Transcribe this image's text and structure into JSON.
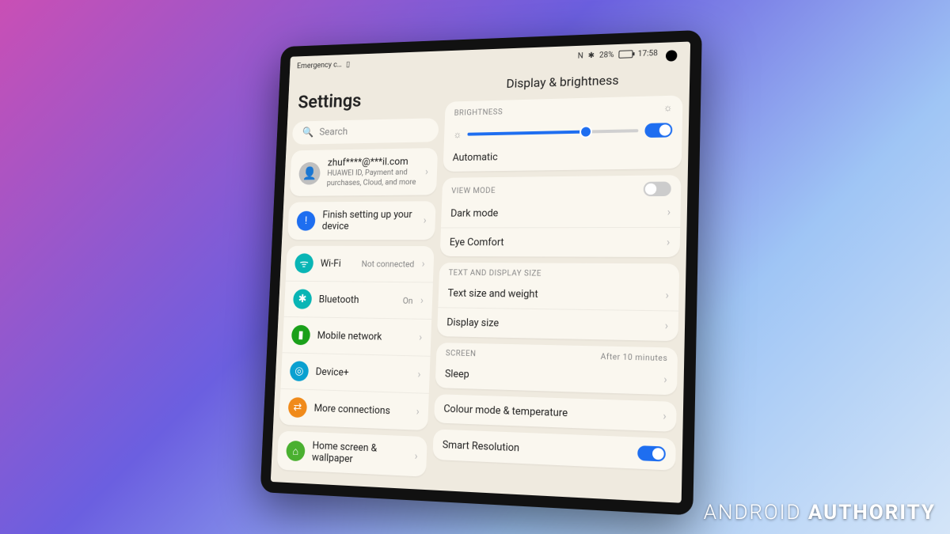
{
  "statusbar": {
    "emergency": "Emergency c…",
    "nfc": "N",
    "bluetooth": "✱",
    "battery_text": "28%",
    "time": "17:58"
  },
  "sidebar": {
    "title": "Settings",
    "search_placeholder": "Search",
    "account": {
      "email": "zhuf****@***il.com",
      "sub": "HUAWEI ID, Payment and purchases, Cloud, and more"
    },
    "setup_label": "Finish setting up your device",
    "items": [
      {
        "label": "Wi-Fi",
        "value": "Not connected",
        "color": "ic-teal",
        "glyph": "ᯤ"
      },
      {
        "label": "Bluetooth",
        "value": "On",
        "color": "ic-teal",
        "glyph": "✱"
      },
      {
        "label": "Mobile network",
        "value": "",
        "color": "ic-green",
        "glyph": "▮"
      },
      {
        "label": "Device+",
        "value": "",
        "color": "ic-cyan",
        "glyph": "◎"
      },
      {
        "label": "More connections",
        "value": "",
        "color": "ic-orange",
        "glyph": "⇄"
      }
    ],
    "home_label": "Home screen & wallpaper"
  },
  "main": {
    "title": "Display & brightness",
    "brightness_header": "BRIGHTNESS",
    "brightness_percent": 70,
    "automatic_label": "Automatic",
    "automatic_on": true,
    "viewmode_header": "VIEW MODE",
    "viewmode_toggle_on": false,
    "dark_label": "Dark mode",
    "eye_label": "Eye Comfort",
    "textsize_header": "TEXT AND DISPLAY SIZE",
    "textsize_label": "Text size and weight",
    "displaysize_label": "Display size",
    "screen_header": "SCREEN",
    "screen_value": "After 10 minutes",
    "sleep_label": "Sleep",
    "colour_label": "Colour mode & temperature",
    "smartres_label": "Smart Resolution",
    "smartres_on": true
  },
  "watermark": {
    "a": "ANDROID ",
    "b": "AUTHORITY"
  }
}
